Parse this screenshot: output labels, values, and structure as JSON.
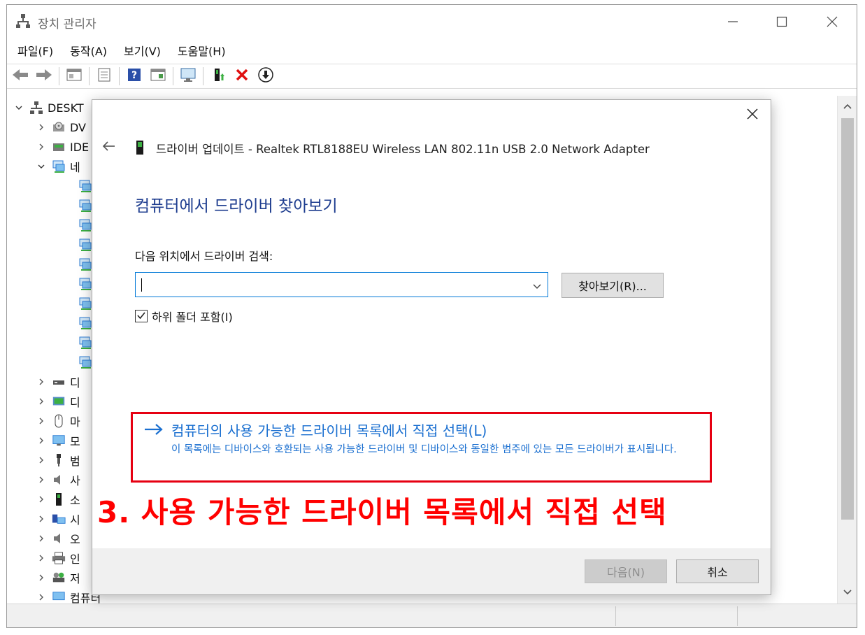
{
  "window": {
    "title": "장치 관리자",
    "app_icon": "device-manager-icon",
    "minimize_icon": "minimize-icon",
    "maximize_icon": "maximize-icon",
    "close_icon": "close-icon"
  },
  "menu": {
    "items": [
      {
        "label": "파일(F)"
      },
      {
        "label": "동작(A)"
      },
      {
        "label": "보기(V)"
      },
      {
        "label": "도움말(H)"
      }
    ]
  },
  "toolbar": {
    "icons": [
      "back-arrow-icon",
      "forward-arrow-icon",
      "properties-window-icon",
      "print-icon",
      "help-icon",
      "device-view-icon",
      "scan-hardware-monitor-icon",
      "update-driver-icon",
      "uninstall-x-icon",
      "disable-down-arrow-icon"
    ]
  },
  "tree": {
    "root_label": "DESKT",
    "items": [
      {
        "label": "DV",
        "icon": "dvd-drive-icon",
        "expanded": false
      },
      {
        "label": "IDE",
        "icon": "ide-controller-icon",
        "expanded": false
      },
      {
        "label": "네",
        "icon": "network-adapter-icon",
        "expanded": true
      },
      {
        "label": "디",
        "icon": "disk-drive-icon",
        "expanded": false
      },
      {
        "label": "디",
        "icon": "display-adapter-icon",
        "expanded": false
      },
      {
        "label": "마",
        "icon": "mouse-icon",
        "expanded": false
      },
      {
        "label": "모",
        "icon": "monitor-icon",
        "expanded": false
      },
      {
        "label": "범",
        "icon": "usb-controller-icon",
        "expanded": false
      },
      {
        "label": "사",
        "icon": "audio-io-icon",
        "expanded": false
      },
      {
        "label": "소",
        "icon": "software-device-icon",
        "expanded": false
      },
      {
        "label": "시",
        "icon": "system-device-icon",
        "expanded": false
      },
      {
        "label": "오",
        "icon": "sound-controller-icon",
        "expanded": false
      },
      {
        "label": "인",
        "icon": "print-queue-icon",
        "expanded": false
      },
      {
        "label": "저",
        "icon": "storage-controller-icon",
        "expanded": false
      },
      {
        "label": "컴퓨터",
        "icon": "computer-icon",
        "expanded": false
      }
    ],
    "network_child_icon": "network-adapter-icon"
  },
  "dialog": {
    "close_icon": "close-icon",
    "back_icon": "back-arrow-icon",
    "device_icon": "usb-device-icon",
    "header": "드라이버 업데이트 - Realtek RTL8188EU Wireless LAN 802.11n USB 2.0 Network Adapter",
    "heading": "컴퓨터에서 드라이버 찾아보기",
    "search_label": "다음 위치에서 드라이버 검색:",
    "search_value": "",
    "browse_button": "찾아보기(R)...",
    "include_subfolders_label": "하위 폴더 포함(I)",
    "include_subfolders_checked": true,
    "pick_link_title": "컴퓨터의 사용 가능한 드라이버 목록에서 직접 선택(L)",
    "pick_link_desc": "이 목록에는 디바이스와 호환되는 사용 가능한 드라이버 및 디바이스와 동일한 범주에 있는 모든 드라이버가 표시됩니다.",
    "next_button": "다음(N)",
    "cancel_button": "취소"
  },
  "annotation": {
    "text": "3. 사용 가능한 드라이버 목록에서 직접 선택",
    "color": "#ff0000"
  },
  "colors": {
    "accent_blue": "#1a6fd0",
    "heading_blue": "#1e3d8f",
    "highlight_red": "#e60012",
    "input_border": "#0078d7"
  }
}
